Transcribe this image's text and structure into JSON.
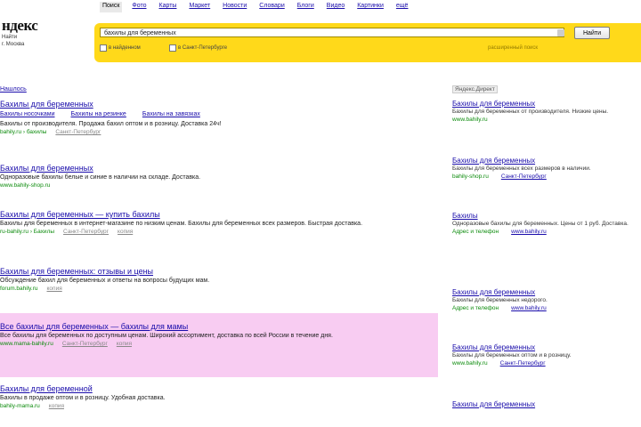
{
  "logo": {
    "mark": "ндекс",
    "line1": "Найти",
    "line2": "г. Москва"
  },
  "services": [
    {
      "label": "Поиск",
      "active": true
    },
    {
      "label": "Фото",
      "active": false
    },
    {
      "label": "Карты",
      "active": false
    },
    {
      "label": "Маркет",
      "active": false
    },
    {
      "label": "Новости",
      "active": false
    },
    {
      "label": "Словари",
      "active": false
    },
    {
      "label": "Блоги",
      "active": false
    },
    {
      "label": "Видео",
      "active": false
    },
    {
      "label": "Картинки",
      "active": false
    },
    {
      "label": "ещё",
      "active": false
    }
  ],
  "search": {
    "query": "бахилы для беременных",
    "button": "Найти",
    "check1": "в найденном",
    "check2": "в Санкт-Петербурге",
    "advanced": "расширенный поиск"
  },
  "found": "Нашлось",
  "results": [
    {
      "title": "Бахилы для беременных",
      "sitelinks": [
        "Бахилы носочками",
        "Бахилы на резинке",
        "Бахилы на завязках"
      ],
      "snippet": "Бахилы от производителя. Продажа бахил оптом и в розницу. Доставка 24ч!",
      "url": "bahily.ru › бахилы",
      "geo": "Санкт-Петербург",
      "extra": ""
    },
    {
      "title": "Бахилы для беременных",
      "sitelinks": [],
      "snippet": "Одноразовые бахилы белые и синие в наличии на складе. Доставка.",
      "url": "www.bahily-shop.ru",
      "geo": "",
      "extra": ""
    },
    {
      "title": "Бахилы для беременных — купить бахилы",
      "sitelinks": [],
      "snippet": "Бахилы для беременных в интернет-магазине по низким ценам. Бахилы для беременных всех размеров. Быстрая доставка.",
      "url": "ru-bahily.ru › Бахилы",
      "geo": "Санкт-Петербург",
      "extra": "копия"
    },
    {
      "title": "Бахилы для беременных: отзывы и цены",
      "sitelinks": [],
      "snippet": "Обсуждение бахил для беременных и ответы на вопросы будущих мам.",
      "url": "forum.bahily.ru",
      "geo": "",
      "extra": "копия"
    },
    {
      "title": "Все бахилы для беременных — бахилы для мамы",
      "sitelinks": [],
      "snippet": "Все бахилы для беременных по доступным ценам. Широкий ассортимент, доставка по всей России в течение дня.",
      "url": "www.mama-bahily.ru",
      "geo": "Санкт-Петербург",
      "extra": "копия"
    },
    {
      "title": "Бахилы для беременной",
      "sitelinks": [],
      "snippet": "Бахилы в продаже оптом и в розницу. Удобная доставка.",
      "url": "bahily-mama.ru",
      "geo": "",
      "extra": "копия"
    }
  ],
  "ads_header": "Яндекс.Директ",
  "ads": [
    {
      "title": "Бахилы для беременных",
      "snippet": "Бахилы для беременных от производителя. Низкие цены.",
      "url": "www.bahily.ru",
      "geo": ""
    },
    {
      "title": "Бахилы для беременных",
      "snippet": "Бахилы для беременных всех размеров в наличии.",
      "url": "bahily-shop.ru",
      "geo": "Санкт-Петербург"
    },
    {
      "title": "Бахилы",
      "snippet": "Одноразовые бахилы для беременных. Цены от 1 руб. Доставка.",
      "url": "Адрес и телефон",
      "geo": "www.bahily.ru"
    },
    {
      "title": "Бахилы для беременных",
      "snippet": "Бахилы для беременных недорого.",
      "url": "Адрес и телефон",
      "geo": "www.bahily.ru"
    },
    {
      "title": "Бахилы для беременных",
      "snippet": "Бахилы для беременных оптом и в розницу.",
      "url": "www.bahily.ru",
      "geo": "Санкт-Петербург"
    },
    {
      "title": "Бахилы для беременных",
      "snippet": "",
      "url": "",
      "geo": ""
    }
  ]
}
